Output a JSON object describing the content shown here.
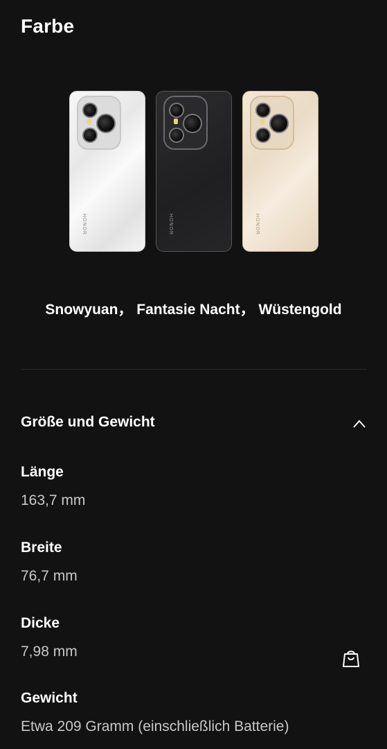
{
  "page": {
    "section_heading": "Farbe",
    "colors_line": "Snowyuan， Fantasie Nacht， Wüstengold",
    "phones": [
      {
        "variant": "white",
        "brand": "HONOR"
      },
      {
        "variant": "black",
        "brand": "HONOR"
      },
      {
        "variant": "gold",
        "brand": "HONOR"
      }
    ],
    "accordion": {
      "title": "Größe und Gewicht",
      "expanded": true,
      "icon": "chevron-up-icon"
    },
    "specs": [
      {
        "label": "Länge",
        "value": "163,7 mm"
      },
      {
        "label": "Breite",
        "value": "76,7 mm"
      },
      {
        "label": "Dicke",
        "value": "7,98 mm"
      },
      {
        "label": "Gewicht",
        "value": "Etwa 209 Gramm (einschließlich Batterie)"
      }
    ],
    "floating_button": {
      "icon": "shopping-bag-icon"
    }
  },
  "colors": {
    "background": "#121212",
    "text": "#ffffff",
    "secondary_text": "#c8c8c8"
  }
}
